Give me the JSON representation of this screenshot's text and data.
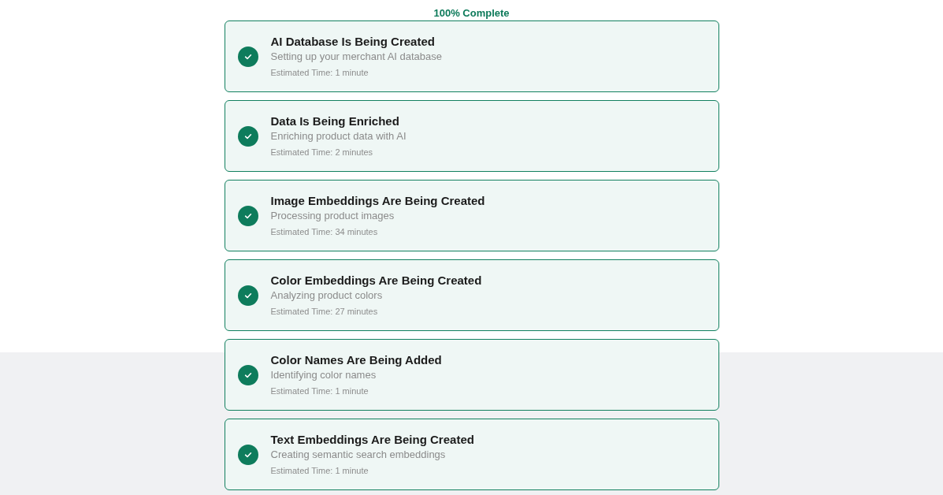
{
  "progress_label": "100% Complete",
  "steps": [
    {
      "title": "AI Database Is Being Created",
      "description": "Setting up your merchant AI database",
      "estimate": "Estimated Time: 1 minute",
      "completed": true
    },
    {
      "title": "Data Is Being Enriched",
      "description": "Enriching product data with AI",
      "estimate": "Estimated Time: 2 minutes",
      "completed": true
    },
    {
      "title": "Image Embeddings Are Being Created",
      "description": "Processing product images",
      "estimate": "Estimated Time: 34 minutes",
      "completed": true
    },
    {
      "title": "Color Embeddings Are Being Created",
      "description": "Analyzing product colors",
      "estimate": "Estimated Time: 27 minutes",
      "completed": true
    },
    {
      "title": "Color Names Are Being Added",
      "description": "Identifying color names",
      "estimate": "Estimated Time: 1 minute",
      "completed": true
    },
    {
      "title": "Text Embeddings Are Being Created",
      "description": "Creating semantic search embeddings",
      "estimate": "Estimated Time: 1 minute",
      "completed": true
    }
  ]
}
